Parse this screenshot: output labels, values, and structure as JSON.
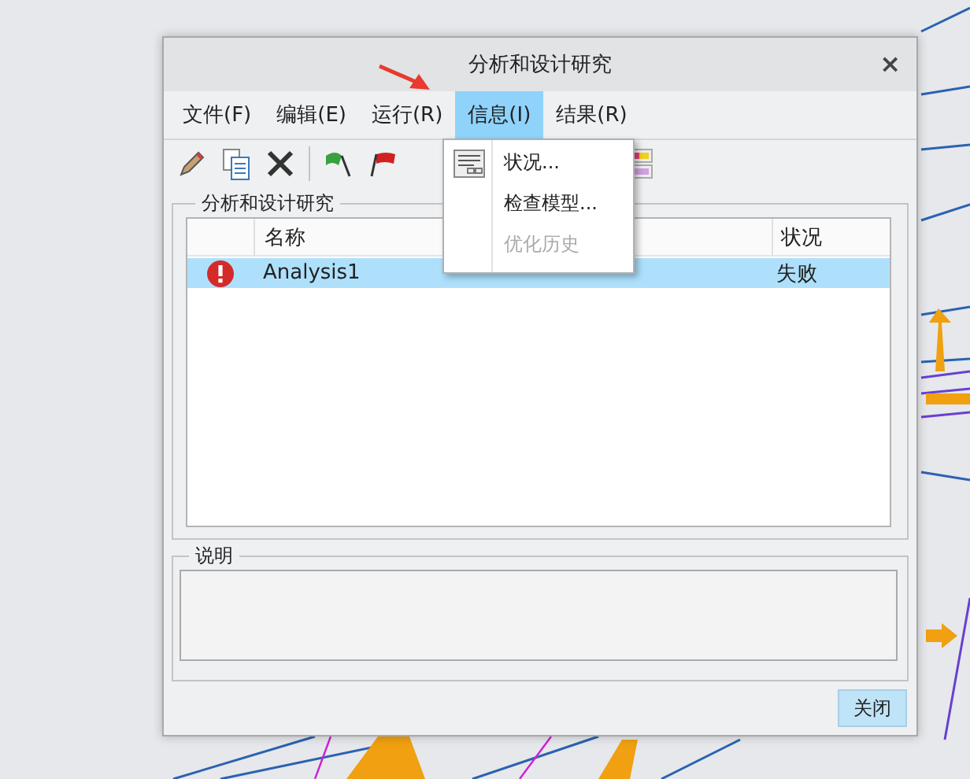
{
  "window": {
    "title": "分析和设计研究",
    "close": "×"
  },
  "menu": [
    {
      "label": "文件(F)",
      "selected": false
    },
    {
      "label": "编辑(E)",
      "selected": false
    },
    {
      "label": "运行(R)",
      "selected": false
    },
    {
      "label": "信息(I)",
      "selected": true
    },
    {
      "label": "结果(R)",
      "selected": false
    }
  ],
  "toolbar": [
    {
      "kind": "pencil"
    },
    {
      "kind": "copy"
    },
    {
      "kind": "delete"
    },
    {
      "kind": "separator"
    },
    {
      "kind": "green-flag"
    },
    {
      "kind": "red-flag"
    },
    {
      "kind": "gap"
    },
    {
      "kind": "color-stack"
    }
  ],
  "dropdown": [
    {
      "label": "状况...",
      "disabled": false,
      "icon": true
    },
    {
      "label": "检查模型...",
      "disabled": false,
      "icon": false
    },
    {
      "label": "优化历史",
      "disabled": true,
      "icon": false
    }
  ],
  "studies": {
    "title": "分析和设计研究",
    "columns": [
      "名称",
      "状况"
    ],
    "rows": [
      {
        "kind": "error",
        "name": "Analysis1",
        "result": "失败",
        "selected": true
      }
    ]
  },
  "description": {
    "title": "说明"
  },
  "buttons": [
    "关闭"
  ]
}
